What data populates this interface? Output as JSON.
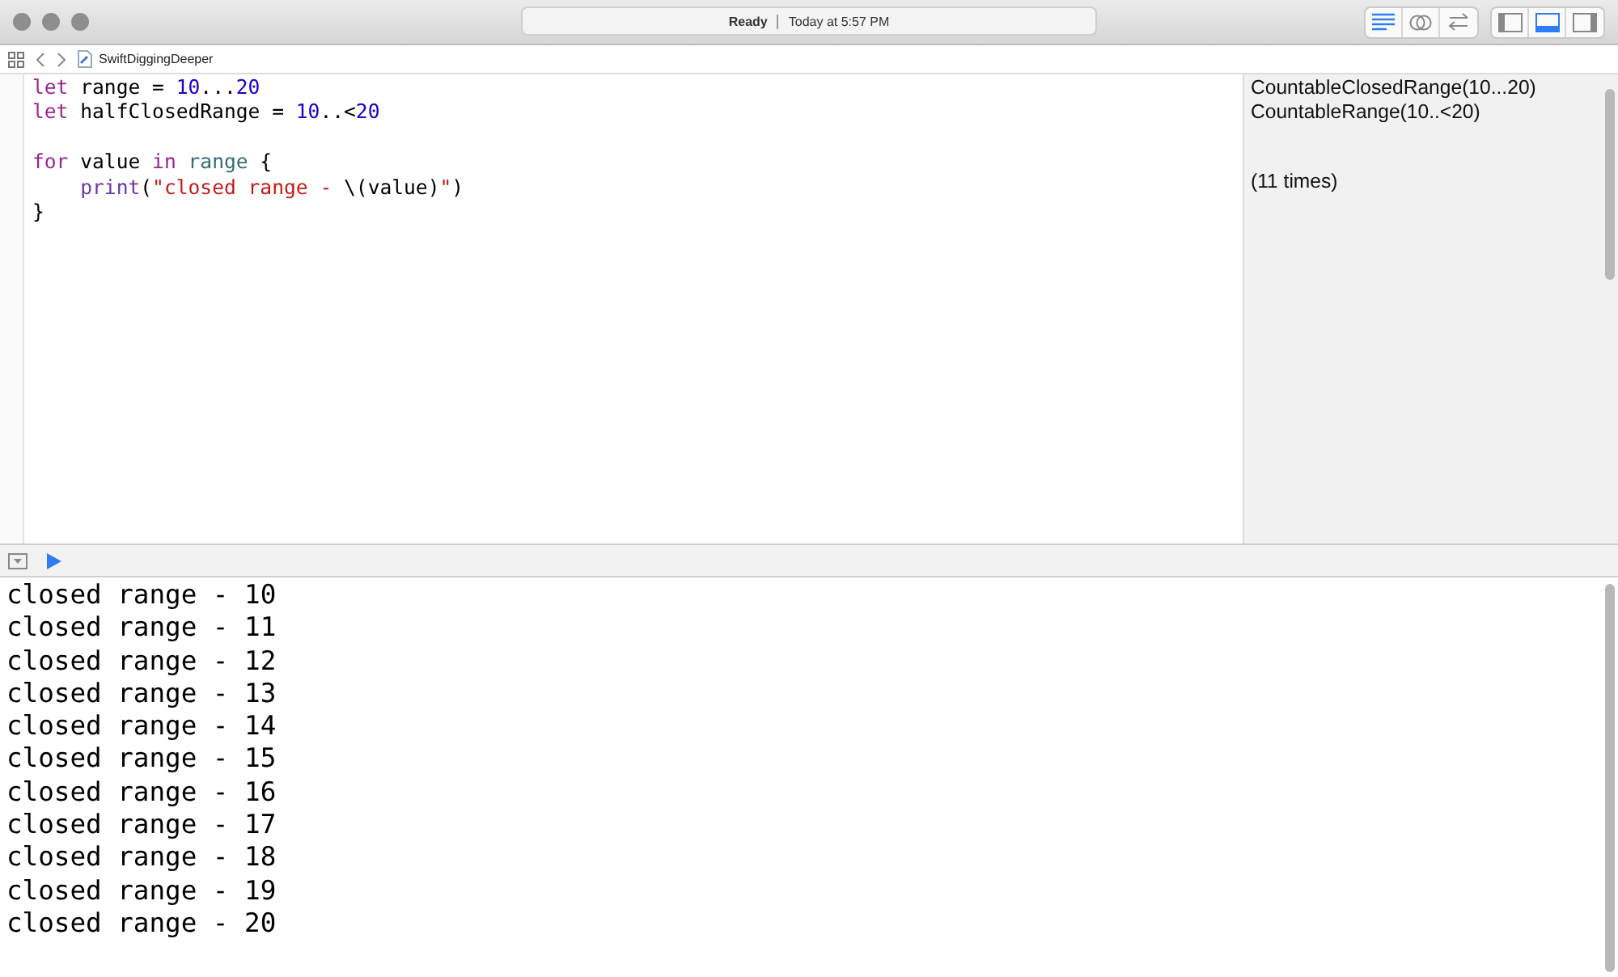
{
  "window": {
    "status": "Ready",
    "time": "Today at 5:57 PM"
  },
  "editor_modes": [
    {
      "kind": "standard",
      "selected": true
    },
    {
      "kind": "assistant",
      "selected": false
    },
    {
      "kind": "version",
      "selected": false
    }
  ],
  "panels": [
    {
      "kind": "left",
      "selected": false
    },
    {
      "kind": "bottom",
      "selected": true
    },
    {
      "kind": "right",
      "selected": false
    }
  ],
  "breadcrumb": {
    "file": "SwiftDiggingDeeper"
  },
  "code_blocks": [
    {
      "lines": [
        {
          "indent": false,
          "result": "CountableClosedRange(10...20)",
          "tokens": [
            {
              "kind": "keyword",
              "text": "let"
            },
            {
              "kind": "plain",
              "text": " range = "
            },
            {
              "kind": "number",
              "text": "10"
            },
            {
              "kind": "plain",
              "text": "..."
            },
            {
              "kind": "number",
              "text": "20"
            }
          ]
        },
        {
          "indent": false,
          "result": "CountableRange(10..<20)",
          "tokens": [
            {
              "kind": "keyword",
              "text": "let"
            },
            {
              "kind": "plain",
              "text": " halfClosedRange = "
            },
            {
              "kind": "number",
              "text": "10"
            },
            {
              "kind": "plain",
              "text": "..<"
            },
            {
              "kind": "number",
              "text": "20"
            }
          ]
        }
      ]
    },
    {
      "lines": [
        {
          "indent": false,
          "tokens": [
            {
              "kind": "keyword",
              "text": "for"
            },
            {
              "kind": "plain",
              "text": " value "
            },
            {
              "kind": "keyword",
              "text": "in"
            },
            {
              "kind": "ref",
              "text": " range"
            },
            {
              "kind": "plain",
              "text": " {"
            }
          ]
        },
        {
          "indent": true,
          "result": "(11 times)",
          "tokens": [
            {
              "kind": "call",
              "text": "print"
            },
            {
              "kind": "plain",
              "text": "("
            },
            {
              "kind": "string",
              "text": "\"closed range - "
            },
            {
              "kind": "plain",
              "text": "\\(value)"
            },
            {
              "kind": "string",
              "text": "\""
            },
            {
              "kind": "plain",
              "text": ")"
            }
          ]
        },
        {
          "indent": false,
          "tokens": [
            {
              "kind": "plain",
              "text": "}"
            }
          ]
        }
      ]
    }
  ],
  "console_output": [
    "closed range - 10",
    "closed range - 11",
    "closed range - 12",
    "closed range - 13",
    "closed range - 14",
    "closed range - 15",
    "closed range - 16",
    "closed range - 17",
    "closed range - 18",
    "closed range - 19",
    "closed range - 20"
  ]
}
